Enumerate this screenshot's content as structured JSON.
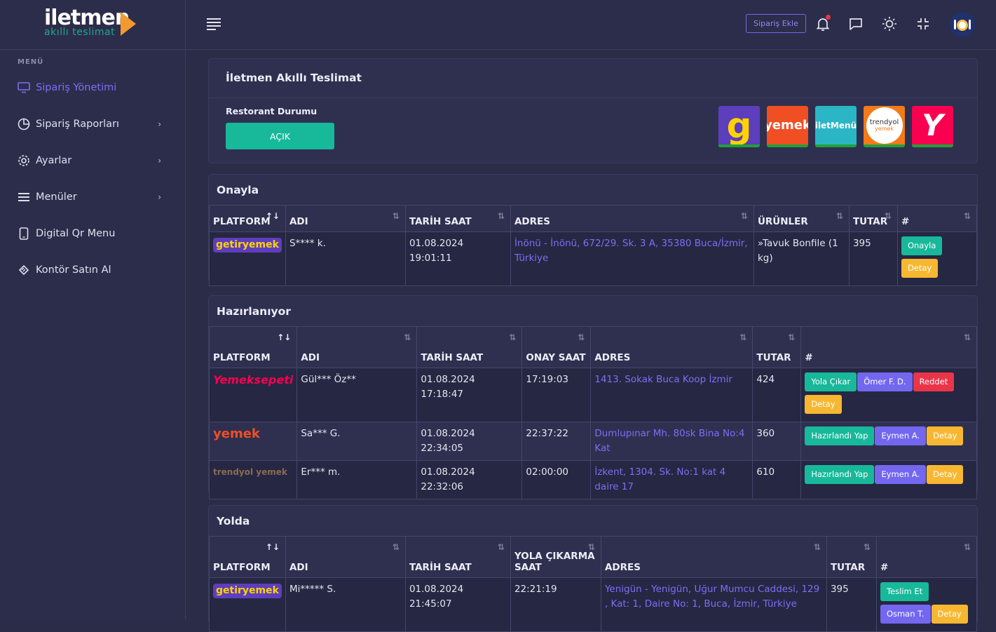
{
  "brand": {
    "name": "iletmen",
    "tagline": "akıllı teslimat"
  },
  "sidebar": {
    "heading": "MENÜ",
    "items": [
      {
        "label": "Sipariş Yönetimi",
        "icon": "monitor-icon",
        "active": true
      },
      {
        "label": "Sipariş Raporları",
        "icon": "pie-chart-icon"
      },
      {
        "label": "Ayarlar",
        "icon": "gear-icon"
      },
      {
        "label": "Menüler",
        "icon": "list-icon"
      },
      {
        "label": "Digital Qr Menu",
        "icon": "tablet-icon"
      },
      {
        "label": "Kontör Satın Al",
        "icon": "ticket-icon"
      }
    ]
  },
  "topbar": {
    "add_order": "Sipariş Ekle"
  },
  "restaurant": {
    "title": "İletmen Akıllı Teslimat",
    "status_label": "Restorant Durumu",
    "status_button": "AÇIK",
    "platforms": [
      "getir",
      "migros yemek",
      "iletMenü",
      "trendyol yemek",
      "yemeksepeti"
    ]
  },
  "onayla": {
    "title": "Onayla",
    "headers": [
      "PLATFORM",
      "ADI",
      "TARİH SAAT",
      "ADRES",
      "ÜRÜNLER",
      "TUTAR",
      "#"
    ],
    "rows": [
      {
        "platform": "getiryemek",
        "name": "S**** k.",
        "datetime": "01.08.2024 19:01:11",
        "address": "İnönü - İnönü, 672/29. Sk. 3 A, 35380 Buca/İzmir, Türkiye",
        "items": "»Tavuk Bonfile (1 kg)",
        "total": "395",
        "btn1": "Onayla",
        "btn2": "Detay"
      }
    ]
  },
  "hazirlaniyor": {
    "title": "Hazırlanıyor",
    "headers": [
      "PLATFORM",
      "ADI",
      "TARİH SAAT",
      "ONAY SAAT",
      "ADRES",
      "TUTAR",
      "#"
    ],
    "rows": [
      {
        "platform": "Yemeksepeti",
        "name": "Gül*** Öz**",
        "datetime": "01.08.2024 17:18:47",
        "time": "17:19:03",
        "address": "1413. Sokak Buca Koop İzmir",
        "total": "424",
        "buttons": [
          "Yola Çıkar",
          "Ömer F. D.",
          "Reddet",
          "Detay"
        ]
      },
      {
        "platform": "yemek",
        "name": "Sa*** G.",
        "datetime": "01.08.2024 22:34:05",
        "time": "22:37:22",
        "address": "Dumlupınar Mh. 80sk Bina No:4 Kat",
        "total": "360",
        "buttons": [
          "Hazırlandı Yap",
          "Eymen A.",
          "Detay"
        ]
      },
      {
        "platform": "trendyol yemek",
        "name": "Er*** m.",
        "datetime": "01.08.2024 22:32:06",
        "time": "02:00:00",
        "address": "İzkent, 1304. Sk. No:1 kat 4 daire 17",
        "total": "610",
        "buttons": [
          "Hazırlandı Yap",
          "Eymen A.",
          "Detay"
        ]
      }
    ]
  },
  "yolda": {
    "title": "Yolda",
    "headers": [
      "PLATFORM",
      "ADI",
      "TARİH SAAT",
      "YOLA ÇIKARMA SAAT",
      "ADRES",
      "TUTAR",
      "#"
    ],
    "rows": [
      {
        "platform": "getiryemek",
        "name": "Mi***** S.",
        "datetime": "01.08.2024 21:45:07",
        "time": "22:21:19",
        "address": "Yenigün - Yenigün, Uğur Mumcu Caddesi, 129 , Kat: 1, Daire No: 1, Buca, İzmir, Türkiye",
        "total": "395",
        "buttons": [
          "Teslim Et",
          "Osman T.",
          "Detay"
        ]
      }
    ]
  }
}
